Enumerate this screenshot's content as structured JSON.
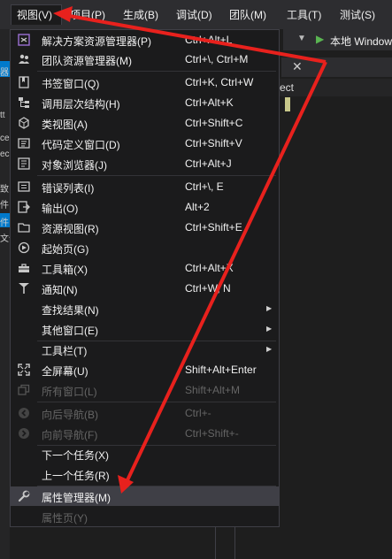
{
  "menubar": {
    "items": [
      {
        "label": "视图(V)"
      },
      {
        "label": "项目(P)"
      },
      {
        "label": "生成(B)"
      },
      {
        "label": "调试(D)"
      },
      {
        "label": "团队(M)"
      },
      {
        "label": "工具(T)"
      },
      {
        "label": "测试(S)"
      }
    ]
  },
  "toolbar": {
    "run_target": "本地 Windows"
  },
  "tab": {
    "close_glyph": "✕"
  },
  "panel": {
    "header_fragment": "ect"
  },
  "left_fragments": [
    "器",
    "tt",
    "ce",
    "ec",
    "致",
    "件",
    "件",
    "文化"
  ],
  "menu": {
    "items": [
      {
        "label": "解决方案资源管理器(P)",
        "shortcut": "Ctrl+Alt+L",
        "icon": "solution-explorer-icon"
      },
      {
        "label": "团队资源管理器(M)",
        "shortcut": "Ctrl+\\, Ctrl+M",
        "icon": "team-explorer-icon"
      },
      {
        "label": "书签窗口(Q)",
        "shortcut": "Ctrl+K, Ctrl+W",
        "icon": "bookmark-icon"
      },
      {
        "label": "调用层次结构(H)",
        "shortcut": "Ctrl+Alt+K",
        "icon": "call-hierarchy-icon"
      },
      {
        "label": "类视图(A)",
        "shortcut": "Ctrl+Shift+C",
        "icon": "class-view-icon"
      },
      {
        "label": "代码定义窗口(D)",
        "shortcut": "Ctrl+Shift+V",
        "icon": "code-definition-icon"
      },
      {
        "label": "对象浏览器(J)",
        "shortcut": "Ctrl+Alt+J",
        "icon": "object-browser-icon"
      },
      {
        "label": "错误列表(I)",
        "shortcut": "Ctrl+\\, E",
        "icon": "error-list-icon"
      },
      {
        "label": "输出(O)",
        "shortcut": "Alt+2",
        "icon": "output-icon"
      },
      {
        "label": "资源视图(R)",
        "shortcut": "Ctrl+Shift+E",
        "icon": "resource-view-icon"
      },
      {
        "label": "起始页(G)",
        "shortcut": "",
        "icon": "start-page-icon"
      },
      {
        "label": "工具箱(X)",
        "shortcut": "Ctrl+Alt+X",
        "icon": "toolbox-icon"
      },
      {
        "label": "通知(N)",
        "shortcut": "Ctrl+W, N",
        "icon": "notification-flag-icon"
      },
      {
        "label": "查找结果(N)",
        "shortcut": ""
      },
      {
        "label": "其他窗口(E)",
        "shortcut": ""
      },
      {
        "label": "工具栏(T)",
        "shortcut": ""
      },
      {
        "label": "全屏幕(U)",
        "shortcut": "Shift+Alt+Enter",
        "icon": "fullscreen-icon"
      },
      {
        "label": "所有窗口(L)",
        "shortcut": "Shift+Alt+M",
        "icon": "all-windows-icon"
      },
      {
        "label": "向后导航(B)",
        "shortcut": "Ctrl+-",
        "icon": "navigate-back-icon"
      },
      {
        "label": "向前导航(F)",
        "shortcut": "Ctrl+Shift+-",
        "icon": "navigate-forward-icon"
      },
      {
        "label": "下一个任务(X)",
        "shortcut": ""
      },
      {
        "label": "上一个任务(R)",
        "shortcut": ""
      },
      {
        "label": "属性管理器(M)",
        "shortcut": "",
        "icon": "wrench-icon"
      },
      {
        "label": "属性页(Y)",
        "shortcut": ""
      }
    ]
  },
  "colors": {
    "menu_bg": "#1b1b1c",
    "menubar_bg": "#2d2d30",
    "highlight": "#3f3f46",
    "disabled_text": "#656565",
    "annotation_arrow": "#e8211d",
    "accent": "#007acc",
    "run_icon": "#5ab552"
  }
}
